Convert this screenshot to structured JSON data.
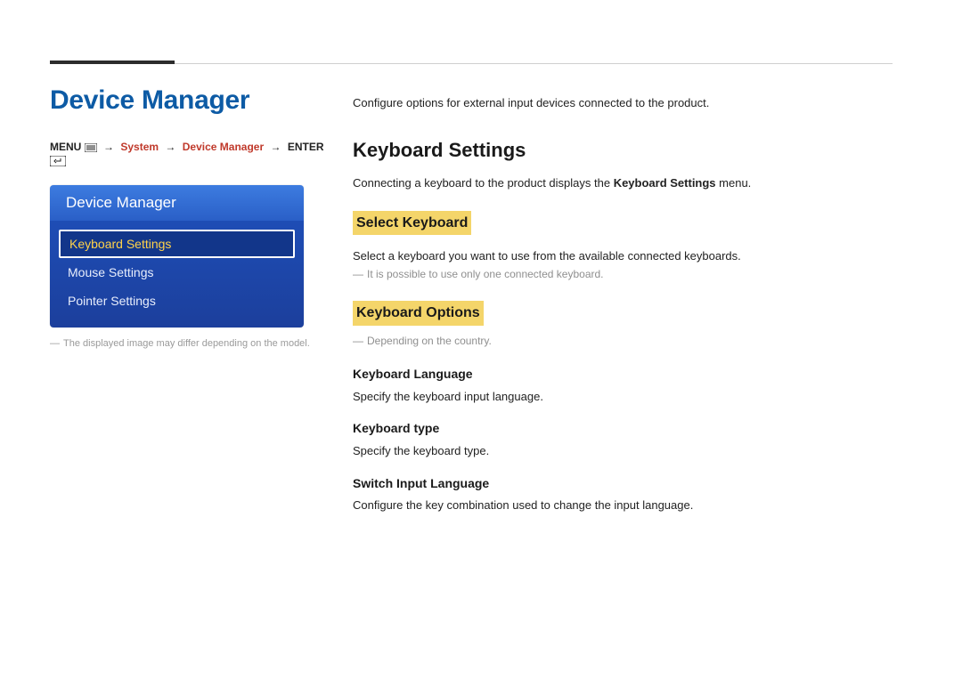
{
  "page_title": "Device Manager",
  "breadcrumb": {
    "menu": "MENU",
    "system": "System",
    "device_manager": "Device Manager",
    "enter": "ENTER"
  },
  "panel": {
    "header": "Device Manager",
    "items": [
      "Keyboard Settings",
      "Mouse Settings",
      "Pointer Settings"
    ]
  },
  "left_footnote": "The displayed image may differ depending on the model.",
  "intro": "Configure options for external input devices connected to the product.",
  "section": {
    "title": "Keyboard Settings",
    "desc_prefix": "Connecting a keyboard to the product displays the ",
    "desc_bold": "Keyboard Settings",
    "desc_suffix": " menu."
  },
  "select_keyboard": {
    "heading": "Select Keyboard",
    "desc": "Select a keyboard you want to use from the available connected keyboards.",
    "note": "It is possible to use only one connected keyboard."
  },
  "keyboard_options": {
    "heading": "Keyboard Options",
    "note": "Depending on the country.",
    "items": [
      {
        "title": "Keyboard Language",
        "desc": "Specify the keyboard input language."
      },
      {
        "title": "Keyboard type",
        "desc": "Specify the keyboard type."
      },
      {
        "title": "Switch Input Language",
        "desc": "Configure the key combination used to change the input language."
      }
    ]
  }
}
